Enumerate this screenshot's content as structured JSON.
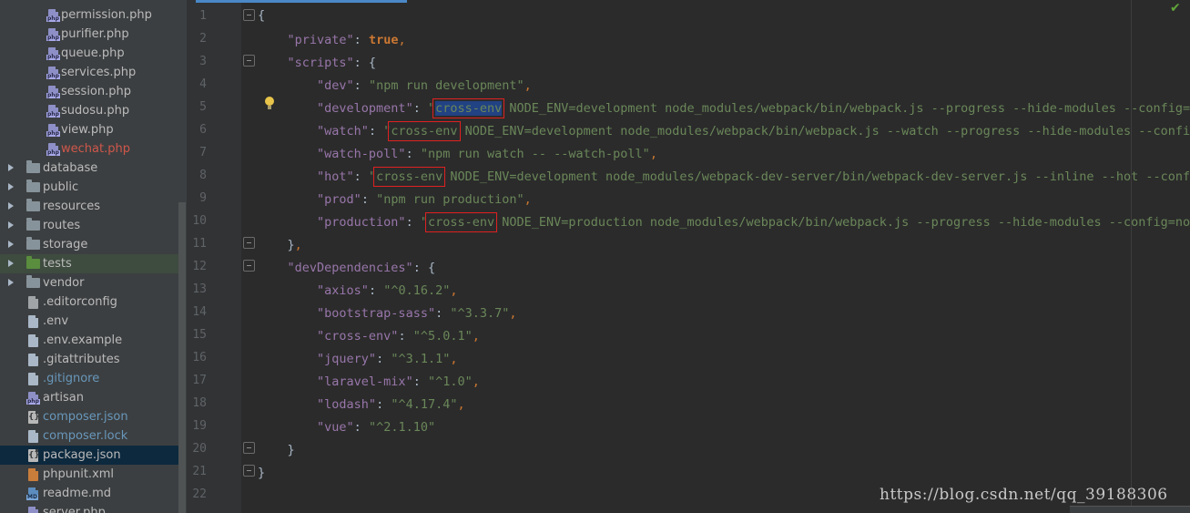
{
  "project_tree": {
    "items": [
      {
        "name": "permission.php",
        "kind": "file",
        "icon": "php-file-icon",
        "indent": 1,
        "color": "default"
      },
      {
        "name": "purifier.php",
        "kind": "file",
        "icon": "php-file-icon",
        "indent": 1,
        "color": "default"
      },
      {
        "name": "queue.php",
        "kind": "file",
        "icon": "php-file-icon",
        "indent": 1,
        "color": "default"
      },
      {
        "name": "services.php",
        "kind": "file",
        "icon": "php-file-icon",
        "indent": 1,
        "color": "default"
      },
      {
        "name": "session.php",
        "kind": "file",
        "icon": "php-file-icon",
        "indent": 1,
        "color": "default"
      },
      {
        "name": "sudosu.php",
        "kind": "file",
        "icon": "php-file-icon",
        "indent": 1,
        "color": "default"
      },
      {
        "name": "view.php",
        "kind": "file",
        "icon": "php-file-icon",
        "indent": 1,
        "color": "default"
      },
      {
        "name": "wechat.php",
        "kind": "file",
        "icon": "php-file-icon",
        "indent": 1,
        "color": "error"
      },
      {
        "name": "database",
        "kind": "folder",
        "icon": "folder-icon",
        "indent": 0,
        "color": "default"
      },
      {
        "name": "public",
        "kind": "folder",
        "icon": "folder-icon",
        "indent": 0,
        "color": "default"
      },
      {
        "name": "resources",
        "kind": "folder",
        "icon": "folder-icon",
        "indent": 0,
        "color": "default"
      },
      {
        "name": "routes",
        "kind": "folder",
        "icon": "folder-icon",
        "indent": 0,
        "color": "default"
      },
      {
        "name": "storage",
        "kind": "folder",
        "icon": "folder-icon",
        "indent": 0,
        "color": "default"
      },
      {
        "name": "tests",
        "kind": "folder",
        "icon": "test-folder-icon",
        "indent": 0,
        "color": "default",
        "tint": true
      },
      {
        "name": "vendor",
        "kind": "folder",
        "icon": "folder-icon",
        "indent": 0,
        "color": "default"
      },
      {
        "name": ".editorconfig",
        "kind": "file",
        "icon": "config-file-icon",
        "indent": 0,
        "color": "default"
      },
      {
        "name": ".env",
        "kind": "file",
        "icon": "text-file-icon",
        "indent": 0,
        "color": "default"
      },
      {
        "name": ".env.example",
        "kind": "file",
        "icon": "text-file-icon",
        "indent": 0,
        "color": "default"
      },
      {
        "name": ".gitattributes",
        "kind": "file",
        "icon": "text-file-icon",
        "indent": 0,
        "color": "default"
      },
      {
        "name": ".gitignore",
        "kind": "file",
        "icon": "text-file-icon",
        "indent": 0,
        "color": "vcs"
      },
      {
        "name": "artisan",
        "kind": "file",
        "icon": "php-file-icon",
        "indent": 0,
        "color": "default"
      },
      {
        "name": "composer.json",
        "kind": "file",
        "icon": "json-file-icon",
        "indent": 0,
        "color": "vcs"
      },
      {
        "name": "composer.lock",
        "kind": "file",
        "icon": "text-file-icon",
        "indent": 0,
        "color": "vcs"
      },
      {
        "name": "package.json",
        "kind": "file",
        "icon": "json-file-icon",
        "indent": 0,
        "color": "default",
        "selected": true
      },
      {
        "name": "phpunit.xml",
        "kind": "file",
        "icon": "xml-file-icon",
        "indent": 0,
        "color": "default"
      },
      {
        "name": "readme.md",
        "kind": "file",
        "icon": "markdown-file-icon",
        "indent": 0,
        "color": "default"
      },
      {
        "name": "server.php",
        "kind": "file",
        "icon": "php-file-icon",
        "indent": 0,
        "color": "default"
      }
    ]
  },
  "editor": {
    "line_numbers": [
      "1",
      "2",
      "3",
      "4",
      "5",
      "6",
      "7",
      "8",
      "9",
      "10",
      "11",
      "12",
      "13",
      "14",
      "15",
      "16",
      "17",
      "18",
      "19",
      "20",
      "21",
      "22"
    ],
    "code": {
      "private_key": "\"private\"",
      "private_val": "true",
      "scripts_key": "\"scripts\"",
      "dev_key": "\"dev\"",
      "dev_val": "\"npm run development\"",
      "development_key": "\"development\"",
      "development_q": "\"",
      "development_env": "cross-env",
      "development_rest": " NODE_ENV=development node_modules/webpack/bin/webpack.js --progress --hide-modules --config=node_modules/laravel-mix/setup/webpack.config.js\"",
      "watch_key": "\"watch\"",
      "watch_q": "\"",
      "watch_env": "cross-env",
      "watch_rest": " NODE_ENV=development node_modules/webpack/bin/webpack.js --watch --progress --hide-modules --config=node_modules/laravel-mix/setup/webpack.config.js\"",
      "watchpoll_key": "\"watch-poll\"",
      "watchpoll_val": "\"npm run watch -- --watch-poll\"",
      "hot_key": "\"hot\"",
      "hot_q": "\"",
      "hot_env": "cross-env",
      "hot_rest": " NODE_ENV=development node_modules/webpack-dev-server/bin/webpack-dev-server.js --inline --hot --config=node_modules/laravel-mix/setup/webpack.config.js\"",
      "prod_key": "\"prod\"",
      "prod_val": "\"npm run production\"",
      "production_key": "\"production\"",
      "production_q": "\"",
      "production_env": "cross-env",
      "production_rest": " NODE_ENV=production node_modules/webpack/bin/webpack.js --progress --hide-modules --config=node_modules/laravel-mix/setup/webpack.config.js\"",
      "devdeps_key": "\"devDependencies\"",
      "axios_key": "\"axios\"",
      "axios_val": "\"^0.16.2\"",
      "bootstrap_key": "\"bootstrap-sass\"",
      "bootstrap_val": "\"^3.3.7\"",
      "crossenv_key": "\"cross-env\"",
      "crossenv_val": "\"^5.0.1\"",
      "jquery_key": "\"jquery\"",
      "jquery_val": "\"^3.1.1\"",
      "laravelmix_key": "\"laravel-mix\"",
      "laravelmix_val": "\"^1.0\"",
      "lodash_key": "\"lodash\"",
      "lodash_val": "\"^4.17.4\"",
      "vue_key": "\"vue\"",
      "vue_val": "\"^2.1.10\""
    }
  },
  "watermark": "https://blog.csdn.net/qq_39188306",
  "colors": {
    "keyword_orange": "#cc7832",
    "json_key_purple": "#9876aa",
    "string_green": "#6a8759",
    "annotation_red": "#e02020",
    "selection_blue": "#214283",
    "vcs_blue": "#6897bb",
    "error_red": "#d0574b"
  }
}
